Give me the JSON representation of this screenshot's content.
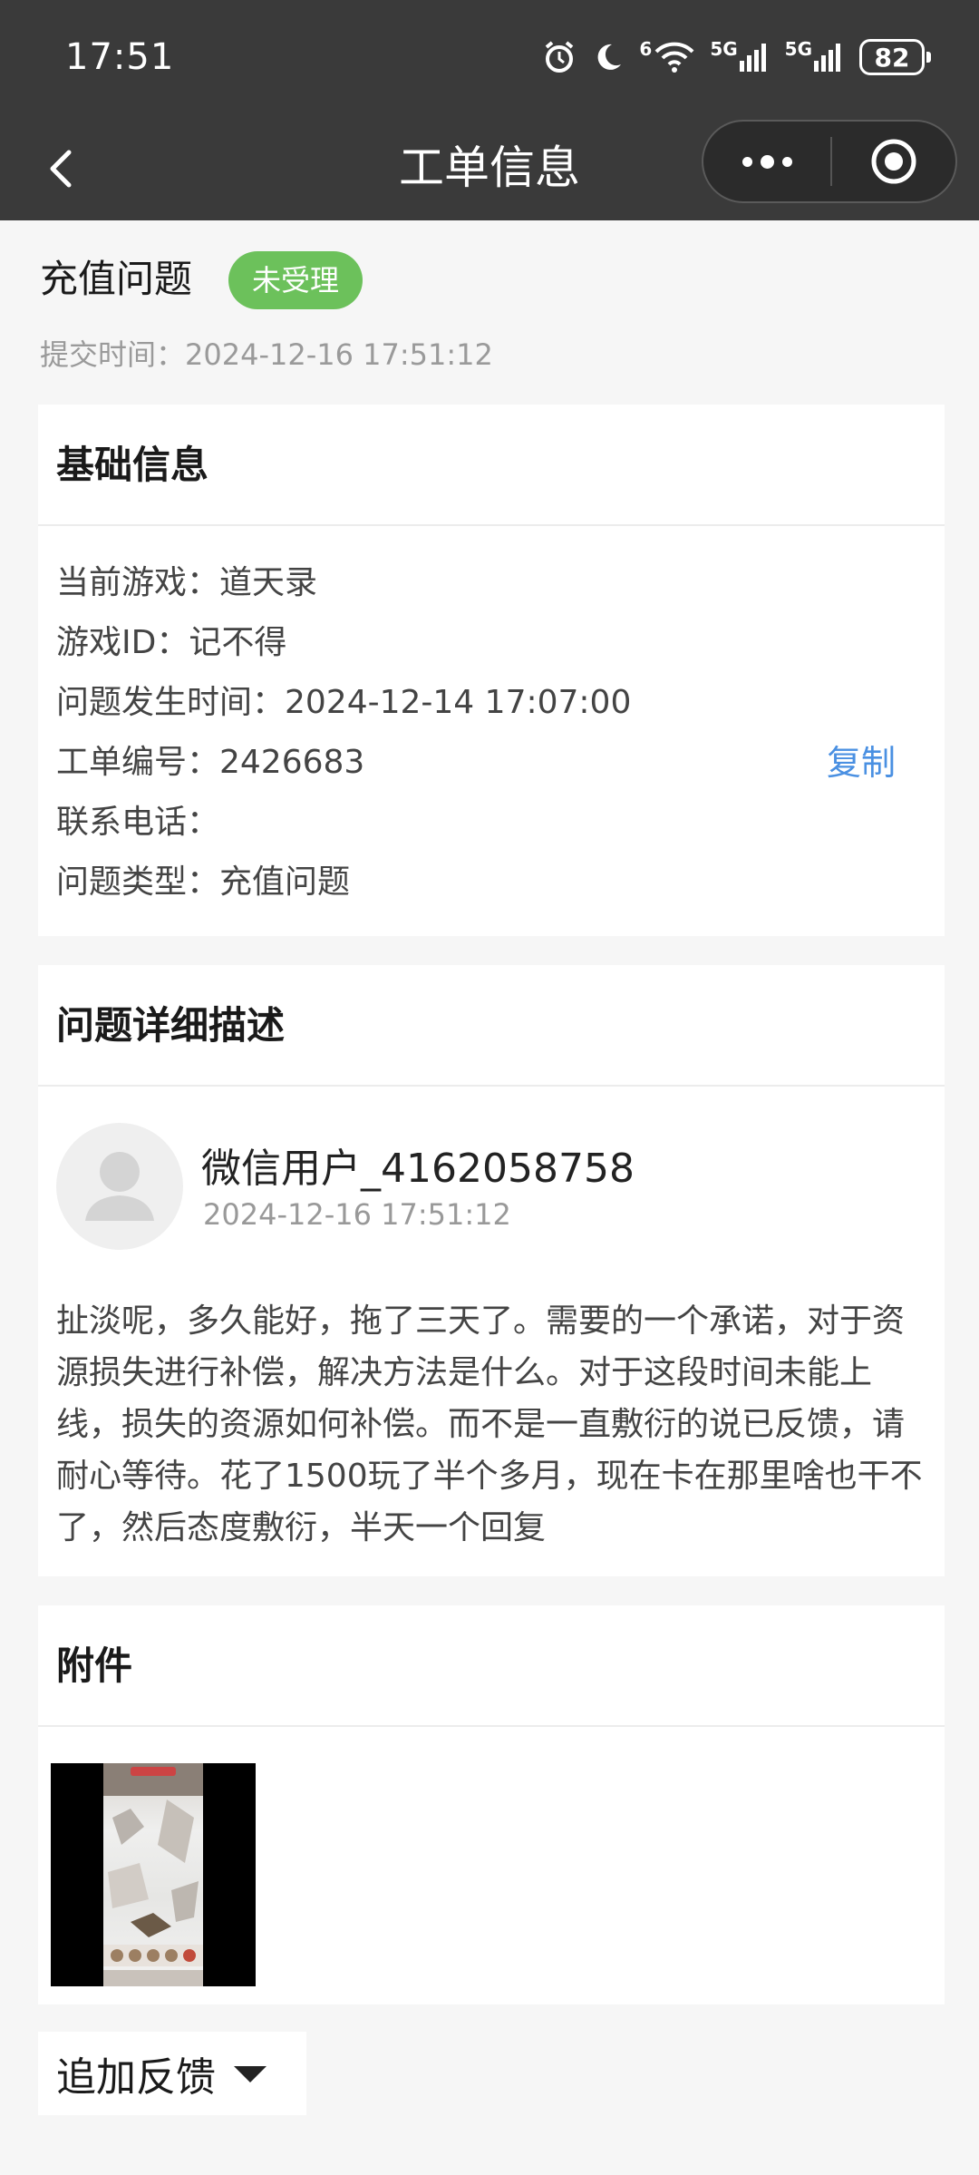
{
  "status_bar": {
    "time": "17:51",
    "network_1": "5G",
    "network_2": "5G",
    "wifi_badge": "6",
    "battery": "82"
  },
  "nav": {
    "title": "工单信息"
  },
  "ticket": {
    "category": "充值问题",
    "status": "未受理",
    "submit_time": "提交时间：2024-12-16 17:51:12",
    "status_color": "#6cc15b"
  },
  "basic_info": {
    "header": "基础信息",
    "rows": [
      "当前游戏：道天录",
      "游戏ID：记不得",
      "问题发生时间：2024-12-14 17:07:00",
      "工单编号：2426683",
      "联系电话：",
      "问题类型：充值问题"
    ],
    "copy_label": "复制",
    "link_color": "#4a90e2"
  },
  "description": {
    "header": "问题详细描述",
    "user_name": "微信用户_4162058758",
    "user_time": "2024-12-16 17:51:12",
    "text": "扯淡呢，多久能好，拖了三天了。需要的一个承诺，对于资源损失进行补偿，解决方法是什么。对于这段时间未能上线，损失的资源如何补偿。而不是一直敷衍的说已反馈，请耐心等待。花了1500玩了半个多月，现在卡在那里啥也干不了，然后态度敷衍，半天一个回复"
  },
  "attachments": {
    "header": "附件"
  },
  "feedback": {
    "label": "追加反馈"
  },
  "icons": {
    "back": "chevron-left-icon",
    "more": "more-dots-icon",
    "close": "target-circle-icon",
    "dropdown": "caret-down-icon",
    "avatar": "default-user-icon"
  }
}
